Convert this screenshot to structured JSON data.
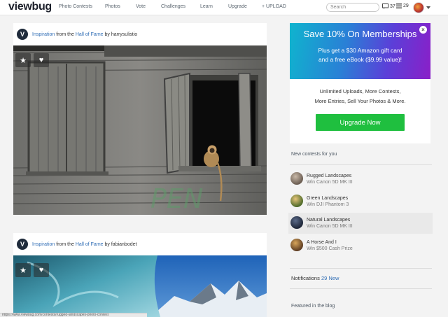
{
  "topbar": {
    "logo": "viewbug",
    "nav": [
      "Photo Contests",
      "Photos",
      "Vote",
      "Challenges",
      "Learn",
      "Upgrade",
      "+ UPLOAD"
    ],
    "search_placeholder": "Search",
    "messages_count": "37",
    "list_count": "29"
  },
  "feed": [
    {
      "prefix": "Inspiration",
      "from": " from the ",
      "hall": "Hall of Fame",
      "by": " by ",
      "user": "harrysulistio"
    },
    {
      "prefix": "Inspiration",
      "from": " from the ",
      "hall": "Hall of Fame",
      "by": " by ",
      "user": "fabianbodet"
    }
  ],
  "photo_overlay": {
    "graffiti": "PEN"
  },
  "promo": {
    "title": "Save 10% On Memberships",
    "line1": "Plus get a $30 Amazon gift card",
    "line2": "and a free eBook ($9.99 value)!",
    "close": "×"
  },
  "offer": {
    "line1": "Unlimited Uploads, More Contests,",
    "line2": "More Entries, Sell Your Photos & More.",
    "button": "Upgrade Now"
  },
  "contests": {
    "heading": "New contests for you",
    "items": [
      {
        "title": "Rugged Landscapes",
        "prize": "Win Canon 5D MK III"
      },
      {
        "title": "Green Landscapes",
        "prize": "Win DJI Phantom 3"
      },
      {
        "title": "Natural Landscapes",
        "prize": "Win Canon 5D MK III"
      },
      {
        "title": "A Horse And I",
        "prize": "Win $500 Cash Prize"
      }
    ]
  },
  "notifications": {
    "label": "Notifications ",
    "count": "29 New"
  },
  "blog": {
    "heading": "Featured in the blog"
  },
  "statusbar": {
    "url": "https://www.viewbug.com/contests/rugged-landscapes-photo-contest"
  }
}
